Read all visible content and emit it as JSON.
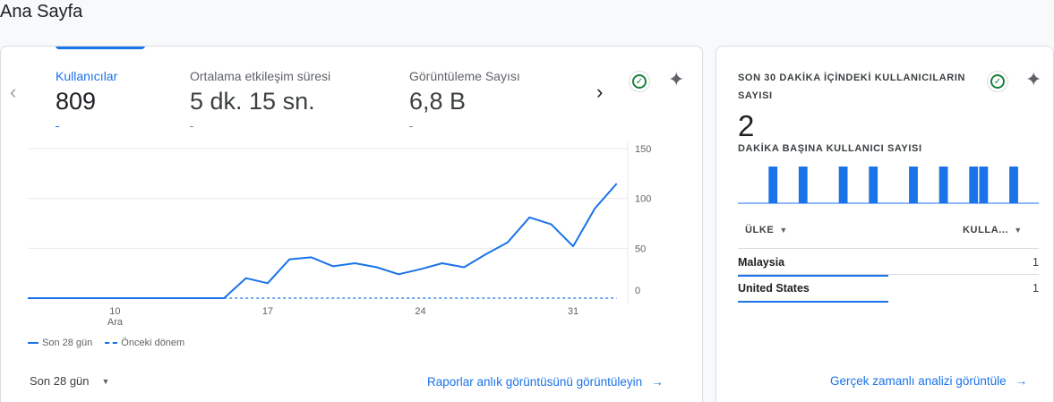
{
  "page": {
    "title": "Ana Sayfa"
  },
  "metrics": [
    {
      "label": "Kullanıcılar",
      "value": "809"
    },
    {
      "label": "Ortalama etkileşim süresi",
      "value": "5 dk. 15 sn."
    },
    {
      "label": "Görüntüleme Sayısı",
      "value": "6,8 B"
    }
  ],
  "chart_data": {
    "type": "line",
    "x_ticks": [
      {
        "day": 10,
        "label": "10",
        "sublabel": "Ara"
      },
      {
        "day": 17,
        "label": "17",
        "sublabel": ""
      },
      {
        "day": 24,
        "label": "24",
        "sublabel": ""
      },
      {
        "day": 31,
        "label": "31",
        "sublabel": ""
      }
    ],
    "y_ticks": [
      0,
      50,
      100,
      150
    ],
    "ylim": [
      0,
      150
    ],
    "xlim": [
      6,
      33.3
    ],
    "series": [
      {
        "name": "Son 28 gün",
        "style": "solid",
        "color": "#1a73e8",
        "x": [
          6,
          7,
          8,
          9,
          10,
          11,
          12,
          13,
          14,
          15,
          16,
          17,
          18,
          19,
          20,
          21,
          22,
          23,
          24,
          25,
          26,
          27,
          28,
          29,
          30,
          31,
          32,
          33
        ],
        "values": [
          0,
          0,
          0,
          0,
          0,
          0,
          0,
          0,
          0,
          0,
          20,
          15,
          39,
          41,
          32,
          35,
          31,
          24,
          29,
          35,
          31,
          44,
          56,
          81,
          74,
          52,
          90,
          115
        ]
      },
      {
        "name": "Önceki dönem",
        "style": "dashed",
        "color": "#1a73e8",
        "x": [
          15,
          33
        ],
        "values": [
          0,
          0
        ]
      }
    ]
  },
  "legend": {
    "current": "Son 28 gün",
    "previous": "Önceki dönem"
  },
  "date_range": {
    "selected": "Son 28 gün"
  },
  "links": {
    "reports": "Raporlar anlık görüntüsünü görüntüleyin",
    "realtime": "Gerçek zamanlı analizi görüntüle"
  },
  "realtime": {
    "title": "SON 30 DAKİKA İÇİNDEKİ KULLANICILARIN SAYISI",
    "count": "2",
    "subtitle": "DAKİKA BAŞINA KULLANICI SAYISI",
    "per_minute": [
      0,
      0,
      0,
      0,
      0,
      0,
      0,
      0,
      0,
      0,
      0,
      0,
      0,
      0,
      0,
      0,
      0,
      0,
      0,
      0,
      0,
      0,
      0,
      0,
      0,
      0,
      0,
      0,
      0,
      0
    ],
    "active_minutes": [
      3,
      6,
      10,
      13,
      17,
      20,
      23,
      24,
      27
    ],
    "col_country": "ÜLKE",
    "col_users": "KULLA...",
    "rows": [
      {
        "country": "Malaysia",
        "users": "1",
        "share": 0.5
      },
      {
        "country": "United States",
        "users": "1",
        "share": 0.5
      }
    ]
  },
  "colors": {
    "accent": "#1a73e8",
    "success": "#188038"
  }
}
